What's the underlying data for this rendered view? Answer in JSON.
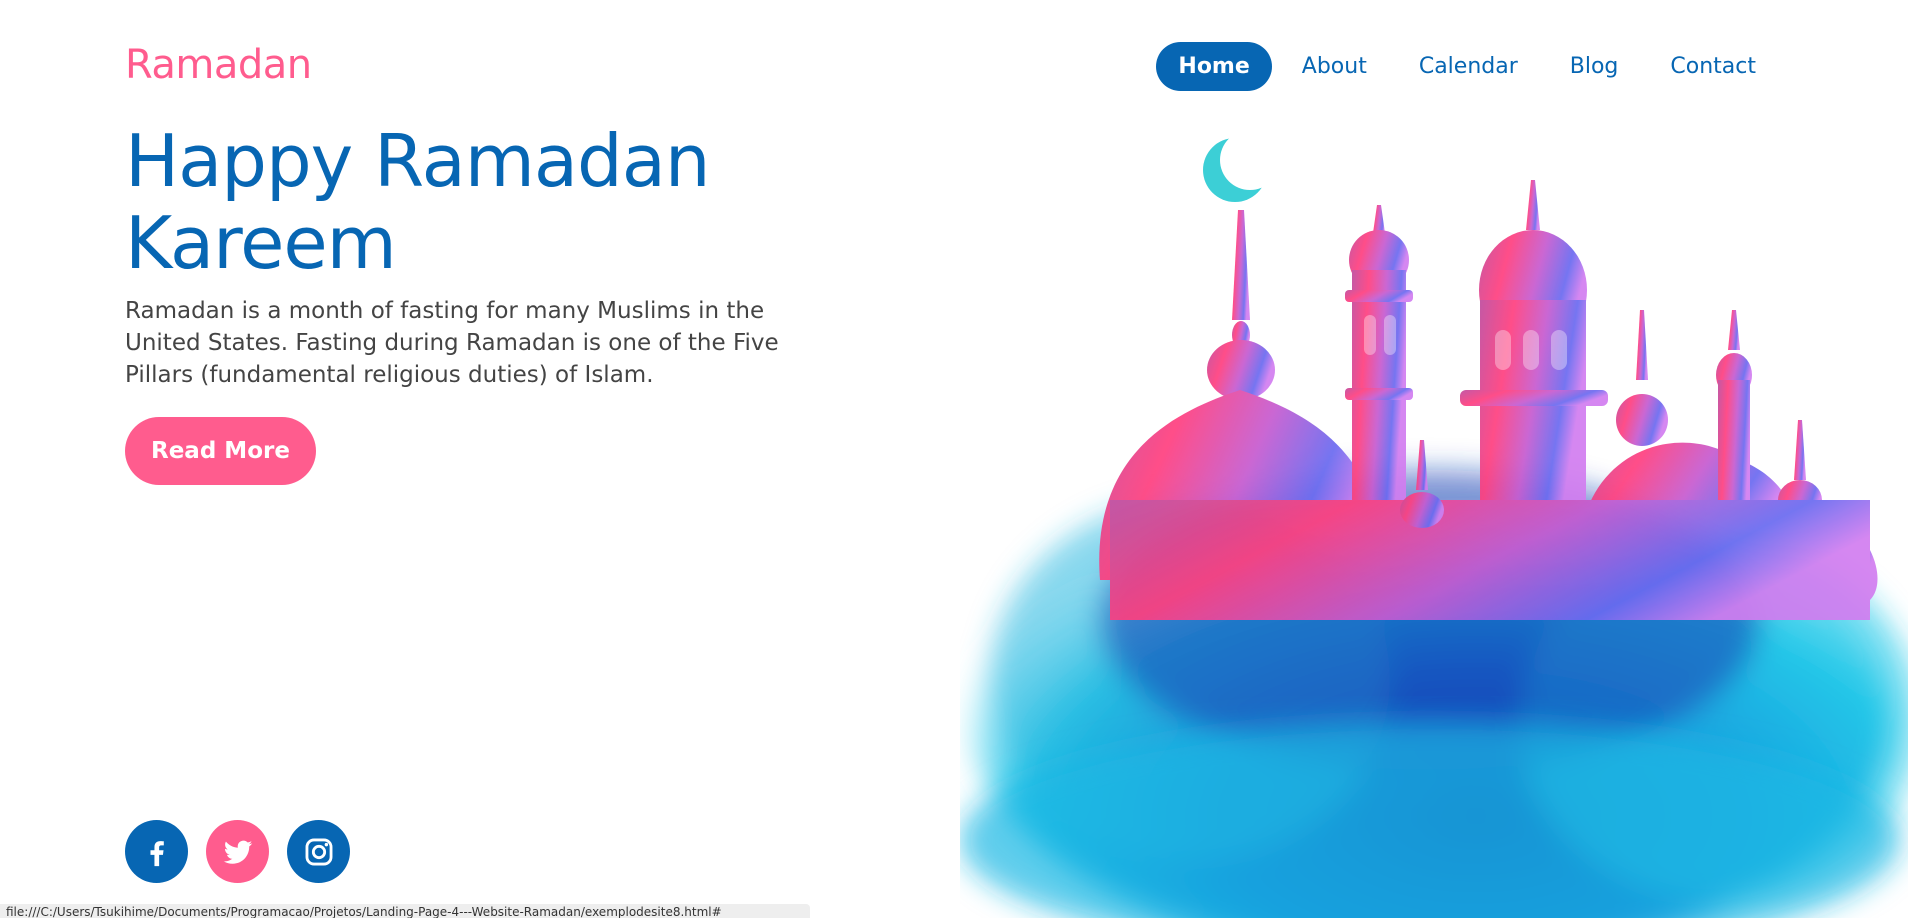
{
  "brand": {
    "logo_text": "Ramadan"
  },
  "nav": {
    "items": [
      {
        "label": "Home",
        "active": true
      },
      {
        "label": "About",
        "active": false
      },
      {
        "label": "Calendar",
        "active": false
      },
      {
        "label": "Blog",
        "active": false
      },
      {
        "label": "Contact",
        "active": false
      }
    ]
  },
  "hero": {
    "title_line1": "Happy Ramadan",
    "title_line2": "Kareem",
    "description": "Ramadan is a month of fasting for many Muslims in the United States. Fasting during Ramadan is one of the Five Pillars (fundamental religious duties) of Islam.",
    "cta_label": "Read More"
  },
  "social": [
    {
      "icon": "facebook-icon"
    },
    {
      "icon": "twitter-icon"
    },
    {
      "icon": "instagram-icon"
    }
  ],
  "status_bar": {
    "url": "file:///C:/Users/Tsukihime/Documents/Programacao/Projetos/Landing-Page-4---Website-Ramadan/exemplodesite8.html#"
  },
  "colors": {
    "primary_blue": "#0766b3",
    "accent_pink": "#ff5c8e"
  }
}
